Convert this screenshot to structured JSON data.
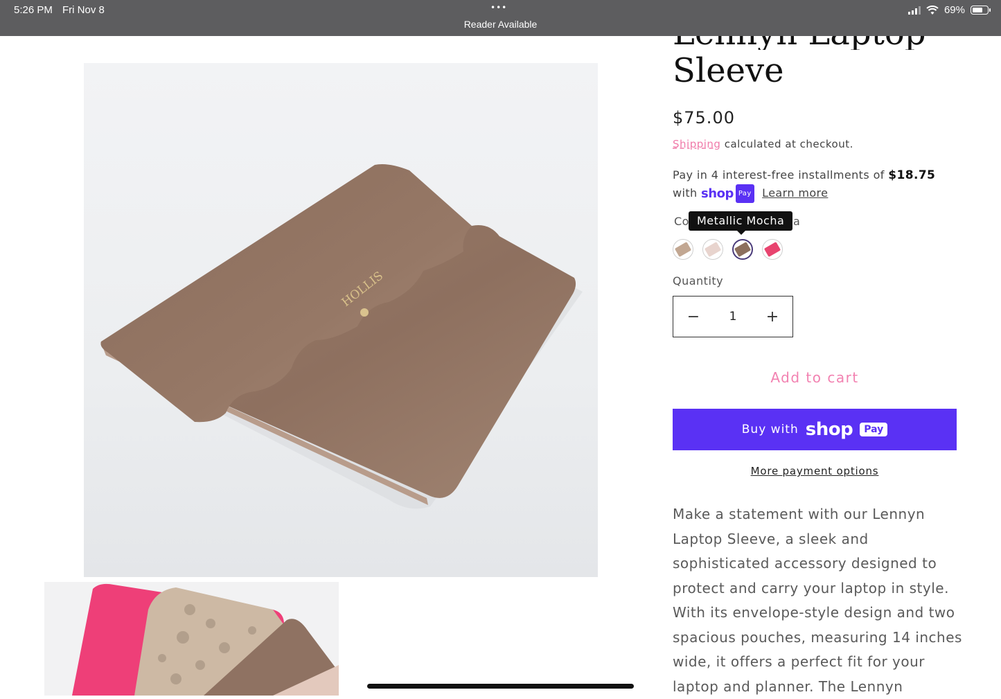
{
  "status_bar": {
    "time": "5:26 PM",
    "date": "Fri Nov 8",
    "dots": "•••",
    "reader": "Reader Available",
    "battery": "69%"
  },
  "product": {
    "title_cut": "Lennyn Laptop",
    "title_line": "Sleeve",
    "price": "$75.00",
    "shipping_link": "Shipping",
    "shipping_rest": " calculated at checkout.",
    "install_text": "Pay in 4 interest-free installments of ",
    "install_amount": "$18.75",
    "install_with": "with",
    "shop_word": "shop",
    "pay_word": "Pay",
    "learn_more": "Learn more",
    "color_label_left": "Co",
    "color_label_right": "a",
    "tooltip": "Metallic Mocha",
    "swatches": [
      {
        "name": "tan-leopard",
        "color": "#c2a792"
      },
      {
        "name": "blush",
        "color": "#e8d4ce"
      },
      {
        "name": "metallic-mocha",
        "color": "#8c6f5d"
      },
      {
        "name": "hot-pink",
        "color": "#e8446f"
      }
    ],
    "quantity_label": "Quantity",
    "quantity_value": "1",
    "minus": "−",
    "plus": "+",
    "add_to_cart": "Add to cart",
    "buy_with": "Buy with",
    "more_payment": "More payment options",
    "description": "Make a statement with our Lennyn Laptop Sleeve, a sleek and sophisticated accessory designed to protect and carry your laptop in style. With its envelope-style design and two spacious pouches, measuring 14 inches wide, it offers a perfect fit for your laptop and planner. The Lennyn"
  },
  "images": {
    "logo_text": "HOLLIS"
  }
}
